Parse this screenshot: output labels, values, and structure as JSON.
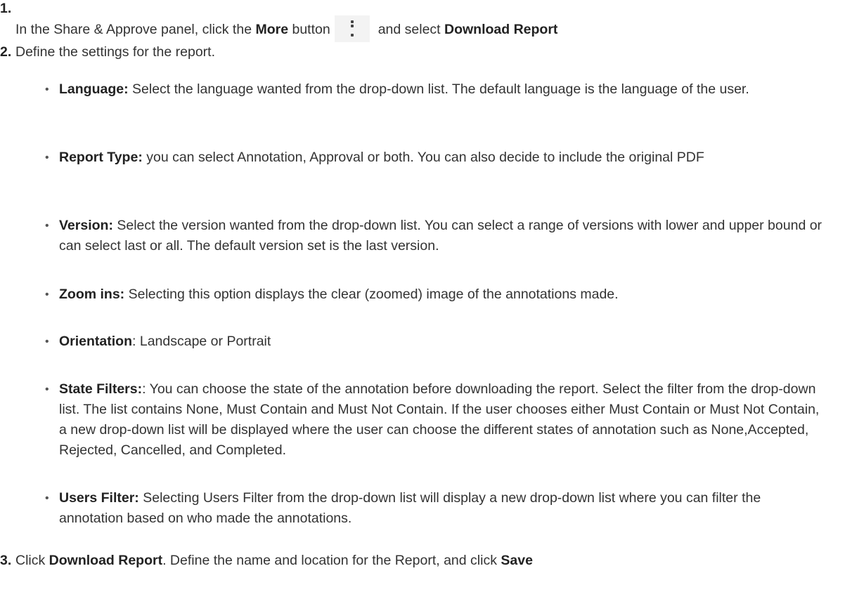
{
  "steps": [
    {
      "num": "1.",
      "pre": "In the Share & Approve panel, click the ",
      "bold1": "More",
      "mid": " button",
      "post": "and select ",
      "bold2": "Download Report",
      "icon": "more-vertical-icon"
    },
    {
      "num": "2.",
      "text": "Define the settings for the report."
    },
    {
      "num": "3.",
      "pre": "Click ",
      "bold1": "Download Report",
      "mid": ". Define the name and location for the Report, and click ",
      "bold2": "Save"
    }
  ],
  "settings": [
    {
      "label": "Language:",
      "text": " Select the language wanted from the drop-down list. The default language is the language of the user."
    },
    {
      "label": "Report Type:",
      "text": " you can select Annotation, Approval or both. You can also decide to include the original PDF"
    },
    {
      "label": "Version:",
      "text": " Select the version wanted from the drop-down list. You can select a range of versions with lower and upper bound or can select last or all. The default version set is the last version."
    },
    {
      "label": "Zoom ins:",
      "text": " Selecting this option displays the clear (zoomed) image of the annotations made."
    },
    {
      "label": "Orientation",
      "text": ": Landscape or Portrait"
    },
    {
      "label": "State Filters:",
      "text": ": You can choose the state of the annotation before downloading the report. Select the filter from the drop-down list. The list contains None, Must Contain and Must Not Contain. If the user chooses either Must Contain or Must Not Contain, a new drop-down list will be displayed where the user can choose the different states of annotation such as None,Accepted, Rejected, Cancelled, and Completed."
    },
    {
      "label": "Users Filter:",
      "text": " Selecting Users Filter from the drop-down list will display a new drop-down list where you can filter the annotation based on who made the annotations."
    }
  ],
  "bullet_glyph": "•"
}
